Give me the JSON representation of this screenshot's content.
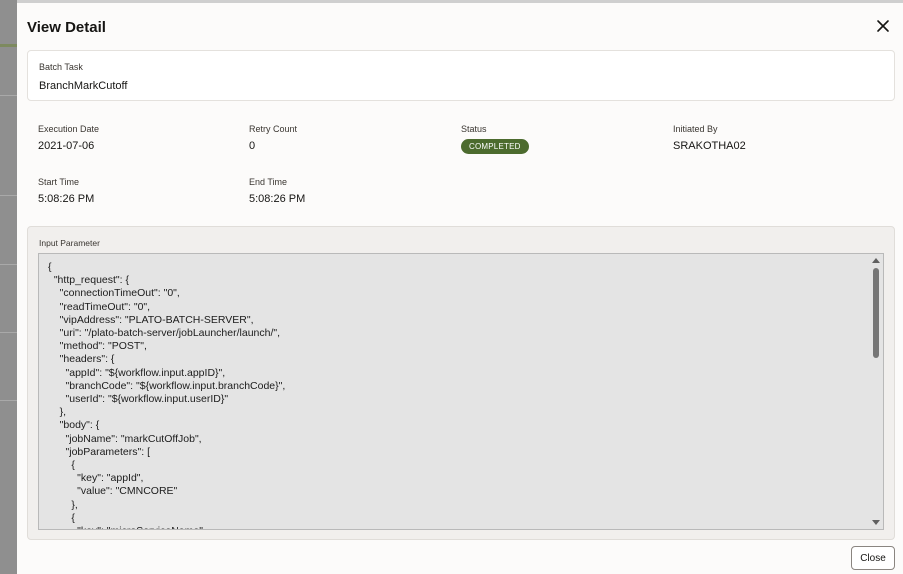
{
  "dialog": {
    "title": "View Detail",
    "close_button_label": "Close"
  },
  "batch_task": {
    "label": "Batch Task",
    "value": "BranchMarkCutoff"
  },
  "details": {
    "execution_date": {
      "label": "Execution Date",
      "value": "2021-07-06"
    },
    "retry_count": {
      "label": "Retry Count",
      "value": "0"
    },
    "status": {
      "label": "Status",
      "value": "COMPLETED",
      "color": "#4c6b2e"
    },
    "initiated_by": {
      "label": "Initiated By",
      "value": "SRAKOTHA02"
    },
    "start_time": {
      "label": "Start Time",
      "value": "5:08:26 PM"
    },
    "end_time": {
      "label": "End Time",
      "value": "5:08:26 PM"
    }
  },
  "input_parameter": {
    "label": "Input Parameter",
    "code": "{\n  \"http_request\": {\n    \"connectionTimeOut\": \"0\",\n    \"readTimeOut\": \"0\",\n    \"vipAddress\": \"PLATO-BATCH-SERVER\",\n    \"uri\": \"/plato-batch-server/jobLauncher/launch/\",\n    \"method\": \"POST\",\n    \"headers\": {\n      \"appId\": \"${workflow.input.appID}\",\n      \"branchCode\": \"${workflow.input.branchCode}\",\n      \"userId\": \"${workflow.input.userID}\"\n    },\n    \"body\": {\n      \"jobName\": \"markCutOffJob\",\n      \"jobParameters\": [\n        {\n          \"key\": \"appId\",\n          \"value\": \"CMNCORE\"\n        },\n        {\n          \"key\": \"microServiceName\","
  },
  "icons": {
    "close": "close-x-icon",
    "scroll_up": "scroll-up-arrow-icon",
    "scroll_down": "scroll-down-arrow-icon"
  }
}
